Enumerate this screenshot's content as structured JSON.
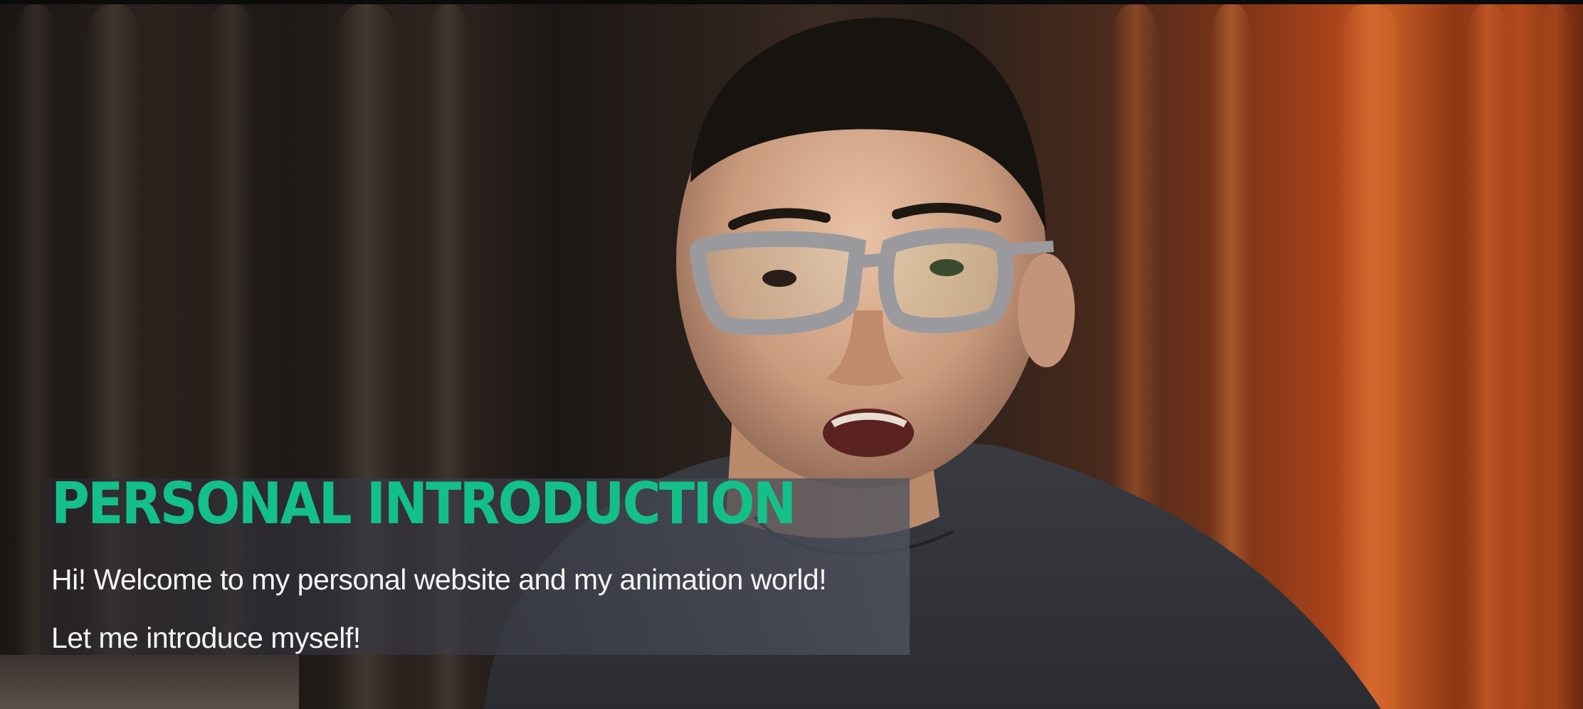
{
  "caption": {
    "title": "PERSONAL INTRODUCTION",
    "line1": "Hi! Welcome to my personal website and my animation world!",
    "line2": "Let me introduce myself!"
  },
  "colors": {
    "title": "#13c08a",
    "body_text": "#f4f4f4",
    "panel": "#4a4c58",
    "curtain_left": "#2a221d",
    "curtain_right": "#c45a24"
  }
}
